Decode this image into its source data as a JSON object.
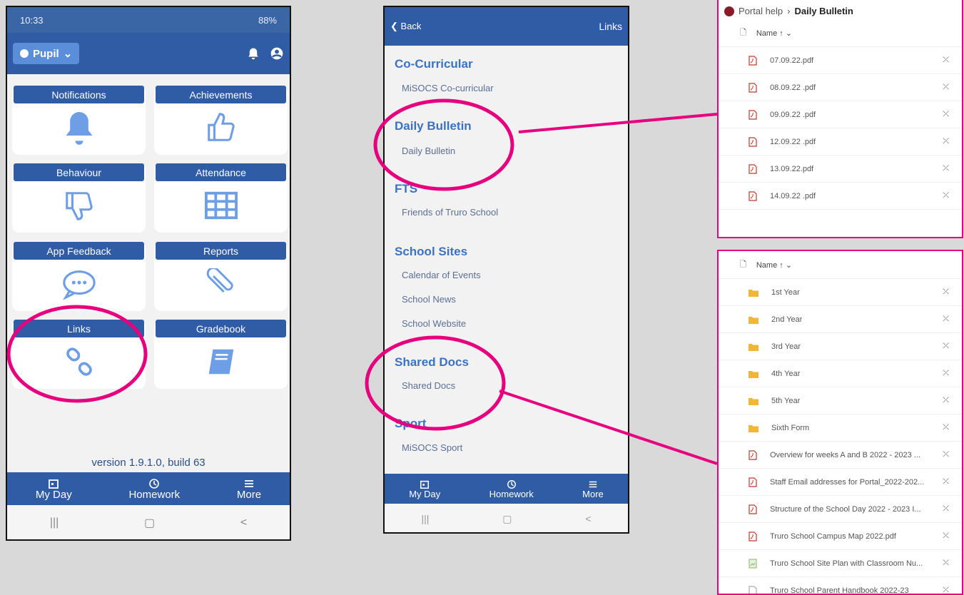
{
  "phone1": {
    "status": {
      "time": "10:33",
      "right": "88%"
    },
    "profile_label": "Pupil",
    "tiles": [
      {
        "label": "Notifications",
        "icon": "bell-icon"
      },
      {
        "label": "Achievements",
        "icon": "thumbs-up-icon"
      },
      {
        "label": "Behaviour",
        "icon": "thumbs-down-icon"
      },
      {
        "label": "Attendance",
        "icon": "table-icon"
      },
      {
        "label": "App Feedback",
        "icon": "chat-icon"
      },
      {
        "label": "Reports",
        "icon": "paperclip-icon"
      },
      {
        "label": "Links",
        "icon": "link-icon"
      },
      {
        "label": "Gradebook",
        "icon": "book-icon"
      }
    ],
    "version": "version 1.9.1.0, build 63",
    "nav": [
      "My Day",
      "Homework",
      "More"
    ]
  },
  "phone2": {
    "back_label": "Back",
    "title": "Links",
    "sections": [
      {
        "heading": "Co-Curricular",
        "items": [
          "MiSOCS Co-curricular"
        ]
      },
      {
        "heading": "Daily Bulletin",
        "items": [
          "Daily Bulletin"
        ]
      },
      {
        "heading": "FTS",
        "items": [
          "Friends of Truro School"
        ]
      },
      {
        "heading": "School Sites",
        "items": [
          "Calendar of Events",
          "School News",
          "School Website"
        ]
      },
      {
        "heading": "Shared Docs",
        "items": [
          "Shared Docs"
        ]
      },
      {
        "heading": "Sport",
        "items": [
          "MiSOCS Sport"
        ]
      }
    ],
    "nav": [
      "My Day",
      "Homework",
      "More"
    ]
  },
  "panel1": {
    "breadcrumb_root": "Portal help",
    "breadcrumb_current": "Daily Bulletin",
    "column_header": "Name ↑ ⌄",
    "files": [
      "07.09.22.pdf",
      "08.09.22 .pdf",
      "09.09.22 .pdf",
      "12.09.22 .pdf",
      "13.09.22.pdf",
      "14.09.22 .pdf"
    ]
  },
  "panel2": {
    "column_header": "Name ↑ ⌄",
    "items": [
      {
        "name": "1st Year",
        "type": "folder"
      },
      {
        "name": "2nd Year",
        "type": "folder"
      },
      {
        "name": "3rd Year",
        "type": "folder"
      },
      {
        "name": "4th Year",
        "type": "folder"
      },
      {
        "name": "5th Year",
        "type": "folder"
      },
      {
        "name": "Sixth Form",
        "type": "folder"
      },
      {
        "name": "Overview for weeks A and B 2022 - 2023 ...",
        "type": "pdf"
      },
      {
        "name": "Staff Email addresses for Portal_2022-202...",
        "type": "pdf"
      },
      {
        "name": "Structure of the School Day 2022 - 2023 I...",
        "type": "pdf"
      },
      {
        "name": "Truro School Campus Map 2022.pdf",
        "type": "pdf"
      },
      {
        "name": "Truro School Site Plan with Classroom Nu...",
        "type": "image"
      },
      {
        "name": "Truro School Parent Handbook 2022-23",
        "type": "doc"
      }
    ]
  },
  "colors": {
    "brand_blue": "#2f5ca4",
    "highlight_magenta": "#e6007e",
    "link_heading": "#3c72c0"
  }
}
